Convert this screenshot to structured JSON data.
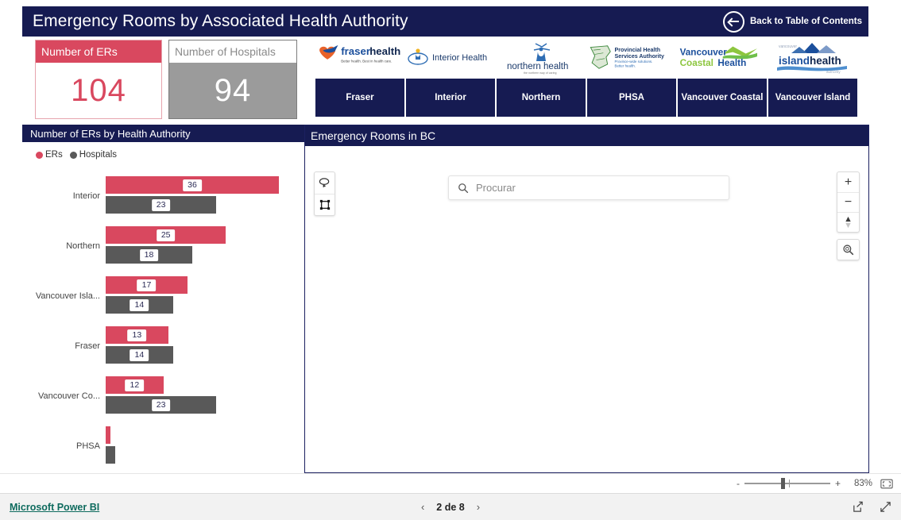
{
  "report": {
    "title": "Emergency Rooms by Associated Health Authority",
    "back_label": "Back to Table of Contents",
    "back_icon": "circle-arrow-left-icon"
  },
  "kpis": [
    {
      "label": "Number of ERs",
      "value": "104",
      "color": "#D9485F"
    },
    {
      "label": "Number of Hospitals",
      "value": "94",
      "color": "#9B9B9B"
    }
  ],
  "logos": [
    {
      "name": "fraser-health-logo",
      "title": "fraserhealth",
      "tagline": "Better health. Best in health care."
    },
    {
      "name": "interior-health-logo",
      "title": "Interior Health"
    },
    {
      "name": "northern-health-logo",
      "title": "northern health",
      "tagline": "the northern way of caring"
    },
    {
      "name": "phsa-logo",
      "title": "Provincial Health Services Authority",
      "tagline": "Province-wide solutions. Better health."
    },
    {
      "name": "vancouver-coastal-health-logo",
      "title": "Vancouver CoastalHealth"
    },
    {
      "name": "island-health-logo",
      "title": "island health",
      "tagline": "authority"
    }
  ],
  "nav_buttons": [
    {
      "label": "Fraser"
    },
    {
      "label": "Interior"
    },
    {
      "label": "Northern"
    },
    {
      "label": "PHSA"
    },
    {
      "label": "Vancouver Coastal"
    },
    {
      "label": "Vancouver Island"
    }
  ],
  "chart_panel": {
    "title": "Number of ERs by Health Authority"
  },
  "map_panel": {
    "title": "Emergency Rooms in BC",
    "search_placeholder": "Procurar",
    "search_value": "",
    "search_icon": "search-icon",
    "tools": [
      {
        "name": "lasso-select-icon"
      },
      {
        "name": "rectangle-select-icon"
      }
    ],
    "controls": [
      {
        "name": "zoom-in-icon",
        "label": "+"
      },
      {
        "name": "zoom-out-icon",
        "label": "−"
      },
      {
        "name": "compass-icon",
        "label": ""
      }
    ],
    "locate": {
      "name": "locate-search-icon"
    }
  },
  "statusbar": {
    "zoom_percent": "83%",
    "minus": "-",
    "plus": "+",
    "fit_icon": "fit-to-page-icon"
  },
  "footer": {
    "brand": "Microsoft Power BI",
    "page_label": "2 de 8",
    "prev_icon": "chevron-left-icon",
    "next_icon": "chevron-right-icon",
    "share_icon": "share-icon",
    "fullscreen_icon": "fullscreen-icon"
  },
  "chart_data": {
    "type": "bar",
    "title": "Number of ERs by Health Authority",
    "orientation": "horizontal",
    "legend": [
      {
        "name": "ERs",
        "color": "#D9485F"
      },
      {
        "name": "Hospitals",
        "color": "#595959"
      }
    ],
    "legend_position": "top-left",
    "categories": [
      "Interior",
      "Northern",
      "Vancouver Isla...",
      "Fraser",
      "Vancouver Co...",
      "PHSA"
    ],
    "series": [
      {
        "name": "ERs",
        "color": "#D9485F",
        "values": [
          36,
          25,
          17,
          13,
          12,
          1
        ]
      },
      {
        "name": "Hospitals",
        "color": "#595959",
        "values": [
          23,
          18,
          14,
          14,
          23,
          2
        ]
      }
    ],
    "data_labels": {
      "ERs": [
        "36",
        "25",
        "17",
        "13",
        "12",
        ""
      ],
      "Hospitals": [
        "23",
        "18",
        "14",
        "14",
        "23",
        ""
      ]
    },
    "xlabel": "",
    "ylabel": "",
    "xlim": [
      0,
      36
    ],
    "grid": false
  }
}
